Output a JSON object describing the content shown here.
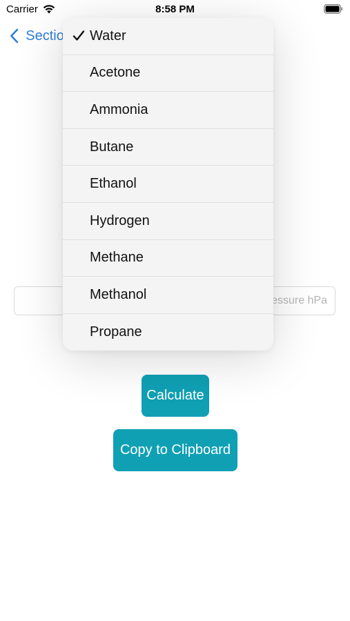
{
  "status_bar": {
    "carrier": "Carrier",
    "time": "8:58 PM",
    "icons": [
      "wifi-icon",
      "battery-icon"
    ]
  },
  "nav": {
    "back_label": "Section",
    "back_icon": "chevron-left-icon"
  },
  "form": {
    "pressure_placeholder": "Pressure hPa"
  },
  "buttons": {
    "calculate": "Calculate",
    "copy": "Copy to Clipboard"
  },
  "menu": {
    "selected": "Water",
    "items": [
      {
        "label": "Water"
      },
      {
        "label": "Acetone"
      },
      {
        "label": "Ammonia"
      },
      {
        "label": "Butane"
      },
      {
        "label": "Ethanol"
      },
      {
        "label": "Hydrogen"
      },
      {
        "label": "Methane"
      },
      {
        "label": "Methanol"
      },
      {
        "label": "Propane"
      }
    ]
  },
  "colors": {
    "accent": "#10a0b4",
    "link": "#2f7fd8"
  }
}
